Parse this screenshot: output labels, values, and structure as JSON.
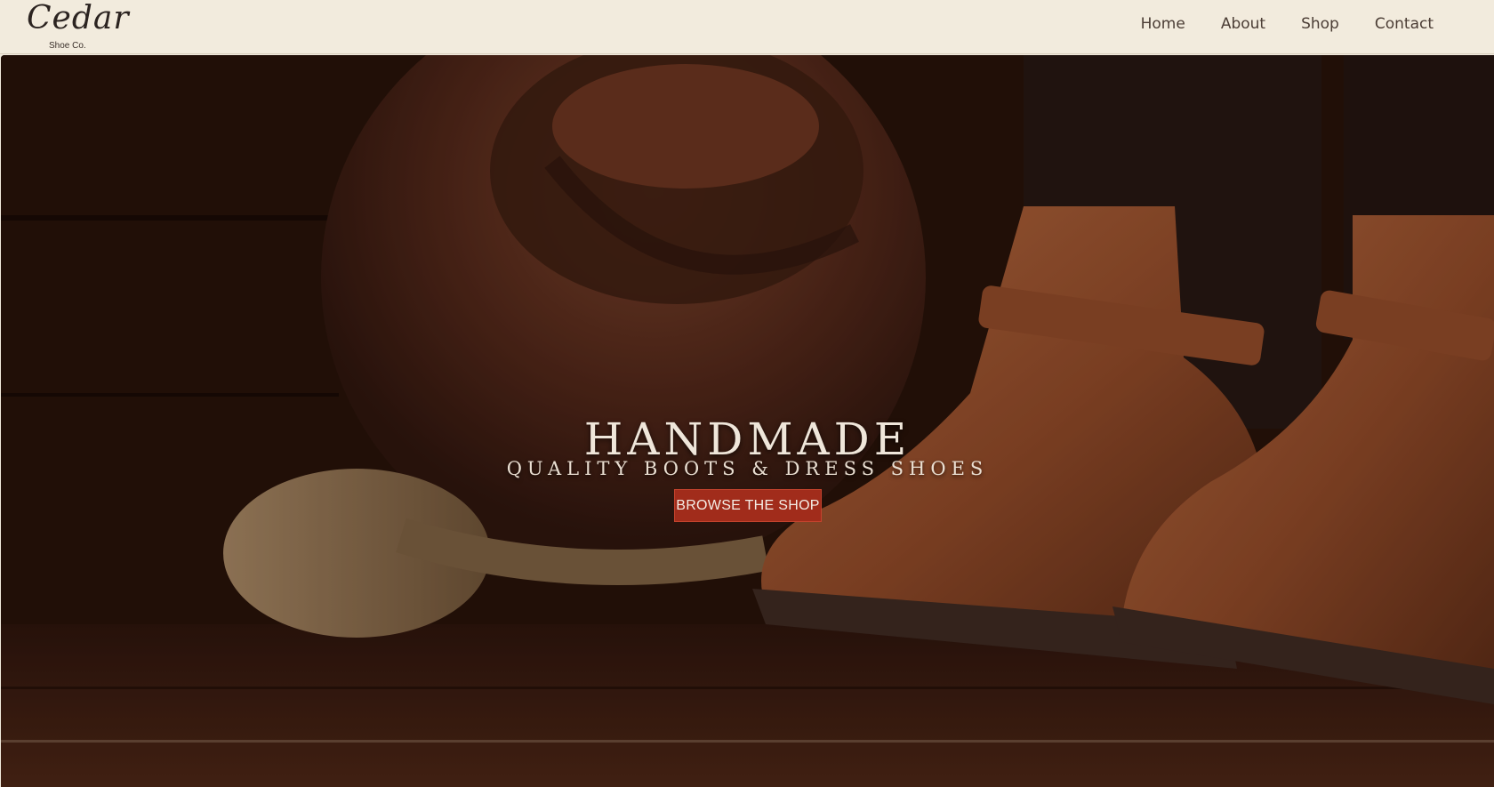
{
  "brand": {
    "name": "Cedar",
    "tagline": "Shoe Co."
  },
  "nav": {
    "items": [
      "Home",
      "About",
      "Shop",
      "Contact"
    ]
  },
  "hero": {
    "title": "HANDMADE",
    "subtitle": "QUALITY BOOTS & DRESS SHOES",
    "cta_label": "BROWSE THE SHOP"
  },
  "colors": {
    "navbar_bg": "#f2ebdd",
    "cta_bg": "#a12c1b",
    "text_light": "#efe6da"
  }
}
